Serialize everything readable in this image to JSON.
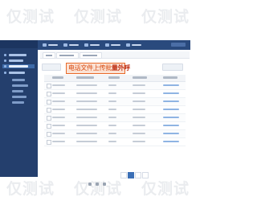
{
  "watermark": {
    "text": "仅测试"
  },
  "callout": {
    "text_main": "电话文件上传批",
    "text_emph": "量外呼",
    "border_color": "#e86a2a",
    "text_color": "#d84a10"
  },
  "theme": {
    "sidebar_bg": "#243f6d",
    "topbar_bg": "#2a4a7d",
    "accent": "#3b6fb6"
  }
}
